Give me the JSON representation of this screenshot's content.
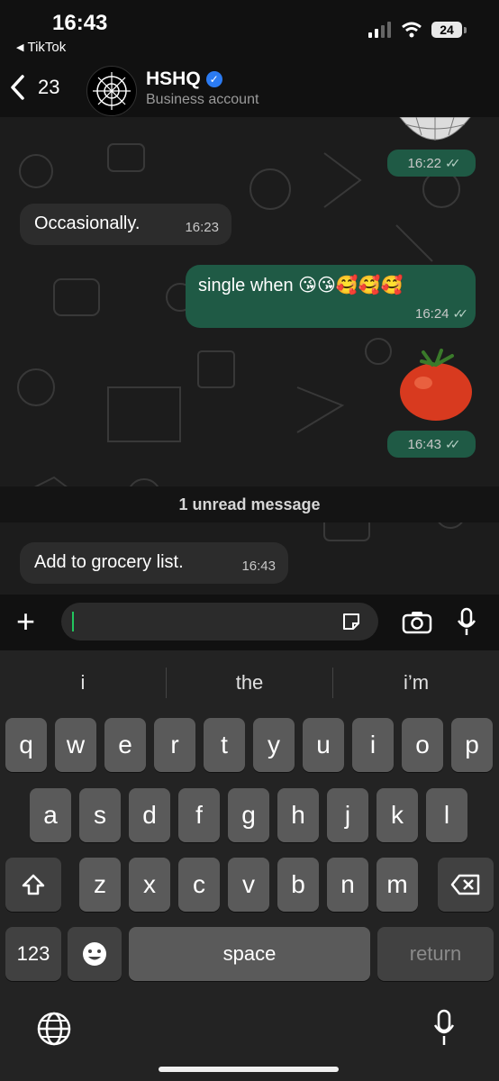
{
  "status_bar": {
    "time": "16:43",
    "back_app": "TikTok",
    "battery": "24"
  },
  "header": {
    "back_count": "23",
    "name": "HSHQ",
    "subtitle": "Business account"
  },
  "messages": [
    {
      "direction": "out",
      "text": "",
      "time": "16:22"
    },
    {
      "direction": "in",
      "text": "Occasionally.",
      "time": "16:23"
    },
    {
      "direction": "out",
      "text": "single when 😘😘🥰🥰🥰",
      "time": "16:24"
    },
    {
      "direction": "out",
      "text": "🍅",
      "time": "16:43"
    },
    {
      "direction": "in",
      "text": "Add to grocery list.",
      "time": "16:43"
    }
  ],
  "unread_label": "1 unread message",
  "input": {
    "value": "",
    "placeholder": ""
  },
  "keyboard": {
    "suggestions": [
      "i",
      "the",
      "i’m"
    ],
    "row1": [
      "q",
      "w",
      "e",
      "r",
      "t",
      "y",
      "u",
      "i",
      "o",
      "p"
    ],
    "row2": [
      "a",
      "s",
      "d",
      "f",
      "g",
      "h",
      "j",
      "k",
      "l"
    ],
    "row3": [
      "z",
      "x",
      "c",
      "v",
      "b",
      "n",
      "m"
    ],
    "numbers_label": "123",
    "space_label": "space",
    "return_label": "return"
  },
  "colors": {
    "outgoing_bubble": "#1f5a45",
    "incoming_bubble": "#2c2c2c",
    "accent": "#22c55e"
  }
}
